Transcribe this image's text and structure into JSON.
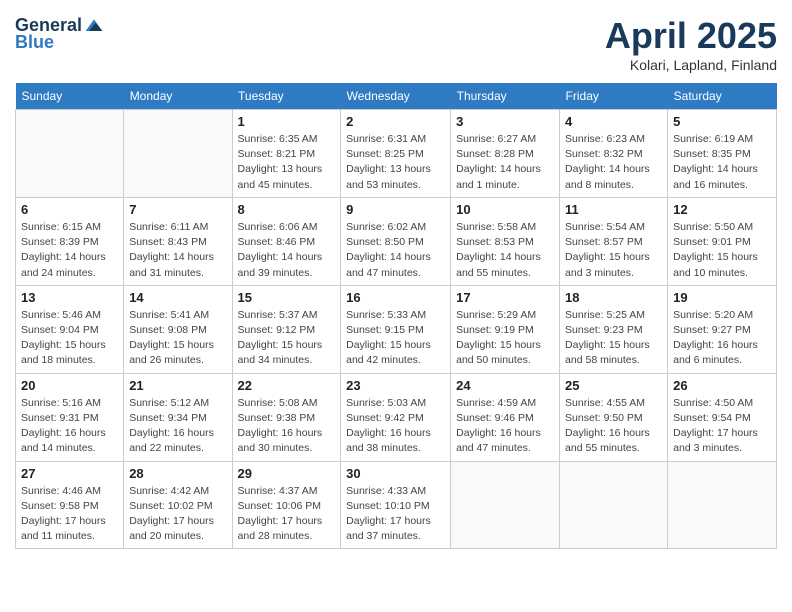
{
  "header": {
    "logo_general": "General",
    "logo_blue": "Blue",
    "month": "April 2025",
    "location": "Kolari, Lapland, Finland"
  },
  "weekdays": [
    "Sunday",
    "Monday",
    "Tuesday",
    "Wednesday",
    "Thursday",
    "Friday",
    "Saturday"
  ],
  "weeks": [
    [
      {
        "day": "",
        "info": ""
      },
      {
        "day": "",
        "info": ""
      },
      {
        "day": "1",
        "info": "Sunrise: 6:35 AM\nSunset: 8:21 PM\nDaylight: 13 hours\nand 45 minutes."
      },
      {
        "day": "2",
        "info": "Sunrise: 6:31 AM\nSunset: 8:25 PM\nDaylight: 13 hours\nand 53 minutes."
      },
      {
        "day": "3",
        "info": "Sunrise: 6:27 AM\nSunset: 8:28 PM\nDaylight: 14 hours\nand 1 minute."
      },
      {
        "day": "4",
        "info": "Sunrise: 6:23 AM\nSunset: 8:32 PM\nDaylight: 14 hours\nand 8 minutes."
      },
      {
        "day": "5",
        "info": "Sunrise: 6:19 AM\nSunset: 8:35 PM\nDaylight: 14 hours\nand 16 minutes."
      }
    ],
    [
      {
        "day": "6",
        "info": "Sunrise: 6:15 AM\nSunset: 8:39 PM\nDaylight: 14 hours\nand 24 minutes."
      },
      {
        "day": "7",
        "info": "Sunrise: 6:11 AM\nSunset: 8:43 PM\nDaylight: 14 hours\nand 31 minutes."
      },
      {
        "day": "8",
        "info": "Sunrise: 6:06 AM\nSunset: 8:46 PM\nDaylight: 14 hours\nand 39 minutes."
      },
      {
        "day": "9",
        "info": "Sunrise: 6:02 AM\nSunset: 8:50 PM\nDaylight: 14 hours\nand 47 minutes."
      },
      {
        "day": "10",
        "info": "Sunrise: 5:58 AM\nSunset: 8:53 PM\nDaylight: 14 hours\nand 55 minutes."
      },
      {
        "day": "11",
        "info": "Sunrise: 5:54 AM\nSunset: 8:57 PM\nDaylight: 15 hours\nand 3 minutes."
      },
      {
        "day": "12",
        "info": "Sunrise: 5:50 AM\nSunset: 9:01 PM\nDaylight: 15 hours\nand 10 minutes."
      }
    ],
    [
      {
        "day": "13",
        "info": "Sunrise: 5:46 AM\nSunset: 9:04 PM\nDaylight: 15 hours\nand 18 minutes."
      },
      {
        "day": "14",
        "info": "Sunrise: 5:41 AM\nSunset: 9:08 PM\nDaylight: 15 hours\nand 26 minutes."
      },
      {
        "day": "15",
        "info": "Sunrise: 5:37 AM\nSunset: 9:12 PM\nDaylight: 15 hours\nand 34 minutes."
      },
      {
        "day": "16",
        "info": "Sunrise: 5:33 AM\nSunset: 9:15 PM\nDaylight: 15 hours\nand 42 minutes."
      },
      {
        "day": "17",
        "info": "Sunrise: 5:29 AM\nSunset: 9:19 PM\nDaylight: 15 hours\nand 50 minutes."
      },
      {
        "day": "18",
        "info": "Sunrise: 5:25 AM\nSunset: 9:23 PM\nDaylight: 15 hours\nand 58 minutes."
      },
      {
        "day": "19",
        "info": "Sunrise: 5:20 AM\nSunset: 9:27 PM\nDaylight: 16 hours\nand 6 minutes."
      }
    ],
    [
      {
        "day": "20",
        "info": "Sunrise: 5:16 AM\nSunset: 9:31 PM\nDaylight: 16 hours\nand 14 minutes."
      },
      {
        "day": "21",
        "info": "Sunrise: 5:12 AM\nSunset: 9:34 PM\nDaylight: 16 hours\nand 22 minutes."
      },
      {
        "day": "22",
        "info": "Sunrise: 5:08 AM\nSunset: 9:38 PM\nDaylight: 16 hours\nand 30 minutes."
      },
      {
        "day": "23",
        "info": "Sunrise: 5:03 AM\nSunset: 9:42 PM\nDaylight: 16 hours\nand 38 minutes."
      },
      {
        "day": "24",
        "info": "Sunrise: 4:59 AM\nSunset: 9:46 PM\nDaylight: 16 hours\nand 47 minutes."
      },
      {
        "day": "25",
        "info": "Sunrise: 4:55 AM\nSunset: 9:50 PM\nDaylight: 16 hours\nand 55 minutes."
      },
      {
        "day": "26",
        "info": "Sunrise: 4:50 AM\nSunset: 9:54 PM\nDaylight: 17 hours\nand 3 minutes."
      }
    ],
    [
      {
        "day": "27",
        "info": "Sunrise: 4:46 AM\nSunset: 9:58 PM\nDaylight: 17 hours\nand 11 minutes."
      },
      {
        "day": "28",
        "info": "Sunrise: 4:42 AM\nSunset: 10:02 PM\nDaylight: 17 hours\nand 20 minutes."
      },
      {
        "day": "29",
        "info": "Sunrise: 4:37 AM\nSunset: 10:06 PM\nDaylight: 17 hours\nand 28 minutes."
      },
      {
        "day": "30",
        "info": "Sunrise: 4:33 AM\nSunset: 10:10 PM\nDaylight: 17 hours\nand 37 minutes."
      },
      {
        "day": "",
        "info": ""
      },
      {
        "day": "",
        "info": ""
      },
      {
        "day": "",
        "info": ""
      }
    ]
  ]
}
